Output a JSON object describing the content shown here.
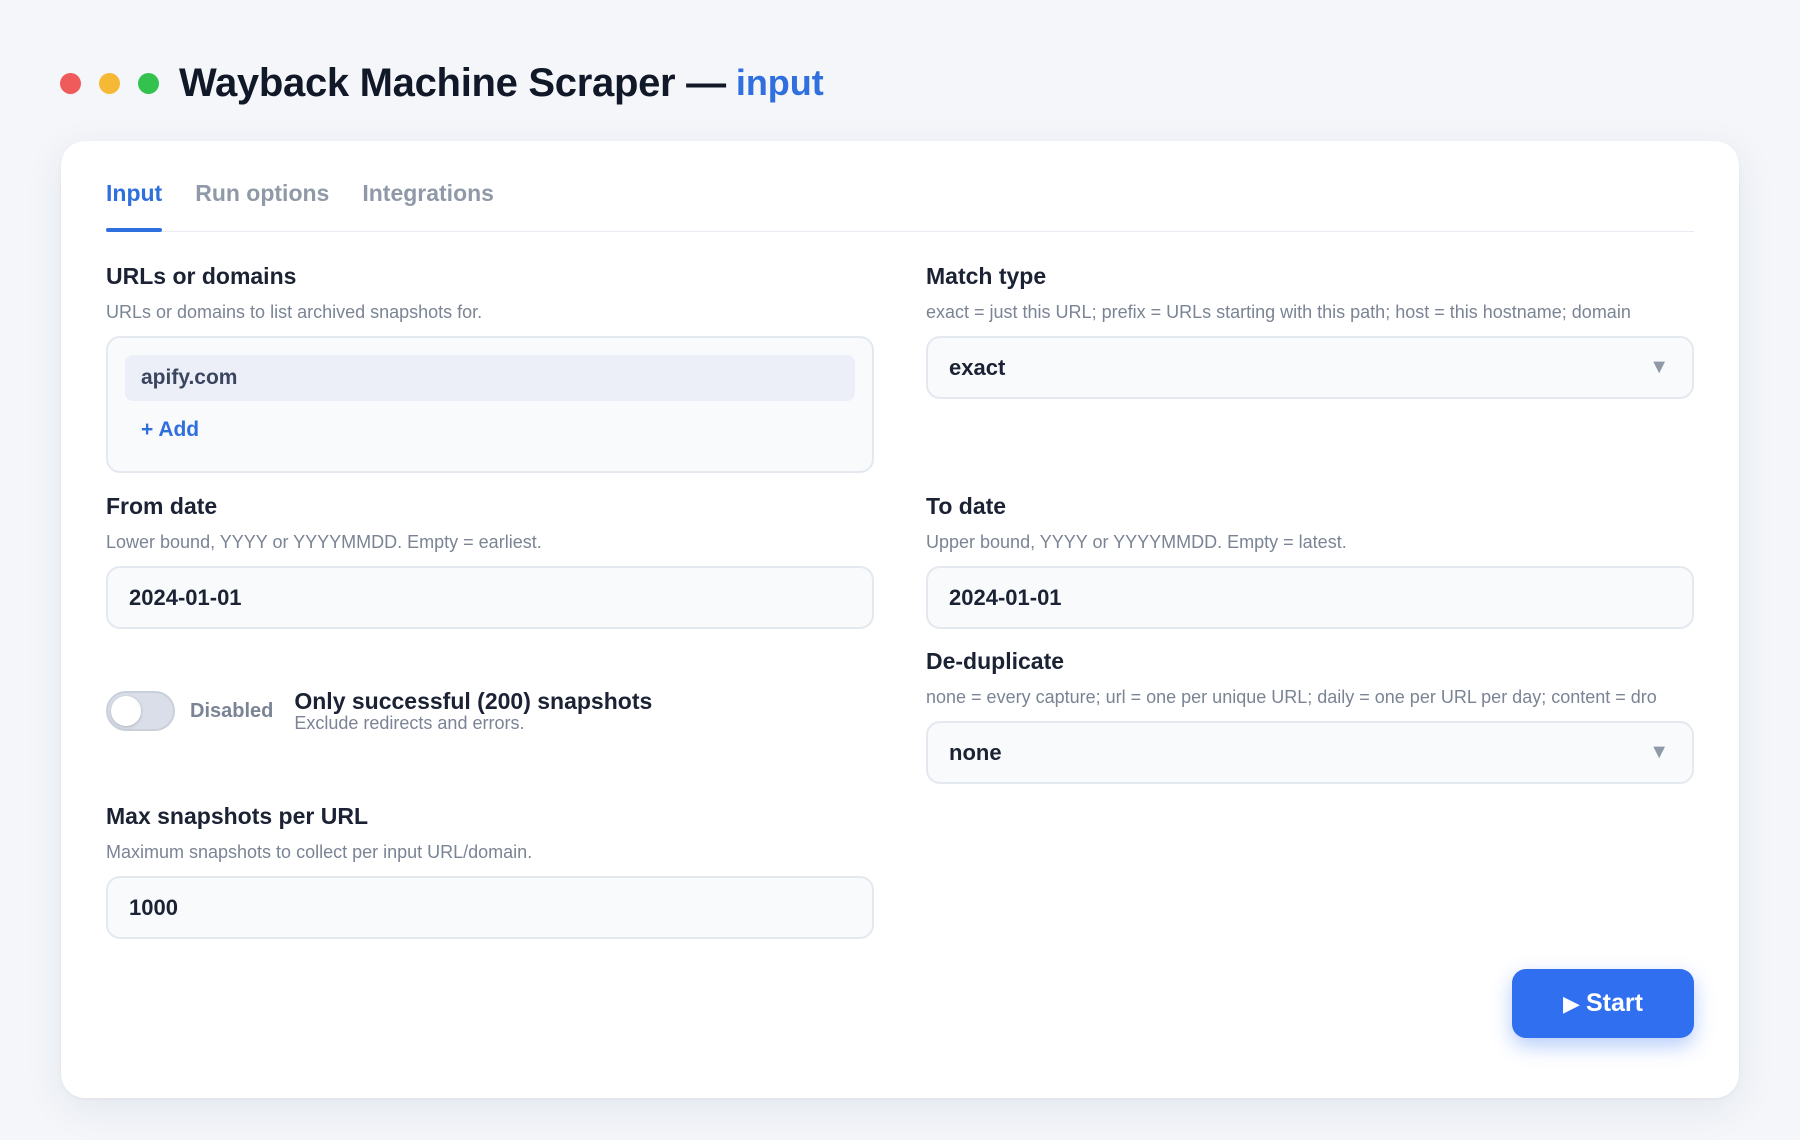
{
  "window": {
    "title": "Wayback Machine Scraper —",
    "subtitle": "input",
    "controls": {
      "close_color": "#ef5a5a",
      "minimize_color": "#f5b935",
      "maximize_color": "#33c24d"
    }
  },
  "tabs": [
    {
      "label": "Input",
      "active": true
    },
    {
      "label": "Run options",
      "active": false
    },
    {
      "label": "Integrations",
      "active": false
    }
  ],
  "fields": {
    "urls": {
      "label": "URLs or domains",
      "help": "URLs or domains to list archived snapshots for.",
      "items": [
        "apify.com"
      ],
      "add_label": "+ Add"
    },
    "match_type": {
      "label": "Match type",
      "help": "exact = just this URL; prefix = URLs starting with this path; host = this hostname; domain",
      "value": "exact"
    },
    "from_date": {
      "label": "From date",
      "help": "Lower bound, YYYY or YYYYMMDD. Empty = earliest.",
      "value": "2024-01-01"
    },
    "to_date": {
      "label": "To date",
      "help": "Upper bound, YYYY or YYYYMMDD. Empty = latest.",
      "value": "2024-01-01"
    },
    "only_successful": {
      "state_label": "Disabled",
      "enabled": false,
      "label": "Only successful (200) snapshots",
      "help": "Exclude redirects and errors."
    },
    "dedupe": {
      "label": "De-duplicate",
      "help": "none = every capture; url = one per unique URL; daily = one per URL per day; content = dro",
      "value": "none"
    },
    "max_snapshots": {
      "label": "Max snapshots per URL",
      "help": "Maximum snapshots to collect per input URL/domain.",
      "value": "1000"
    }
  },
  "start_button": {
    "icon": "play-icon",
    "label": "Start",
    "color": "#2f6ff0"
  },
  "icons": {
    "select_caret": "caret-down-icon"
  }
}
